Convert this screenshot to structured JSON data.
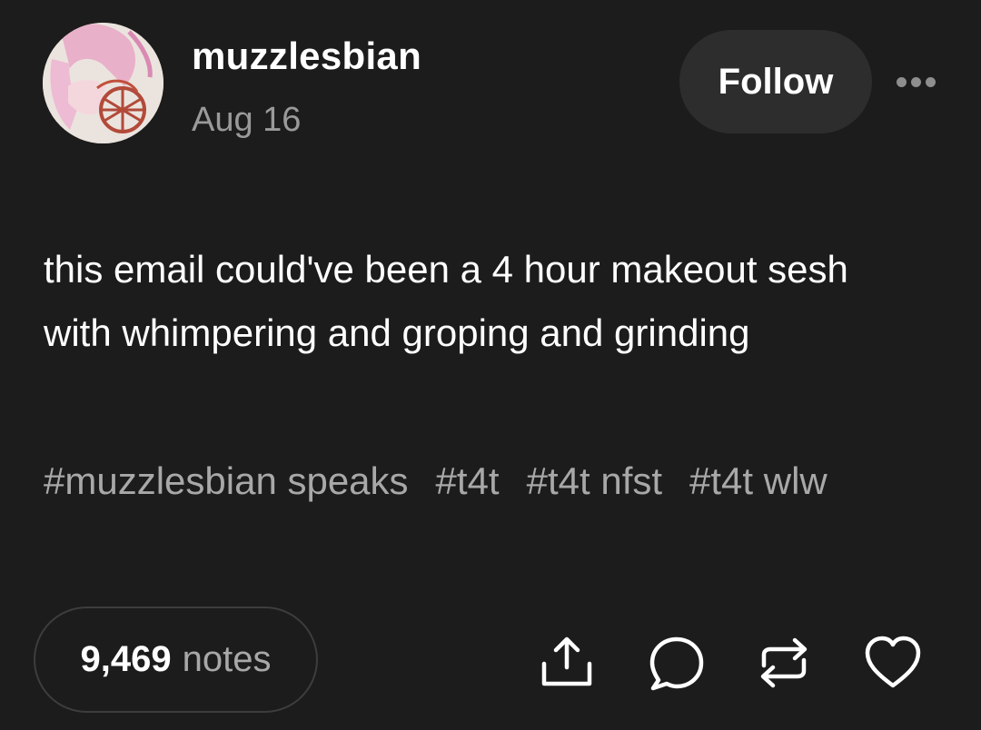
{
  "post": {
    "username": "muzzlesbian",
    "date": "Aug 16",
    "follow_label": "Follow",
    "text": "this email could've been a 4 hour makeout sesh with whimpering and groping and grinding",
    "tags": [
      "#muzzlesbian speaks",
      "#t4t",
      "#t4t nfst",
      "#t4t wlw"
    ],
    "notes_count": "9,469",
    "notes_label": "notes"
  },
  "icons": {
    "more": "more-horizontal-icon",
    "share": "share-icon",
    "reply": "reply-icon",
    "reblog": "reblog-icon",
    "like": "heart-icon"
  },
  "colors": {
    "background": "#1c1c1c",
    "follow_button_bg": "#2d2d2d",
    "secondary_text": "#9a9a9a",
    "tag_text": "#a8a8a8",
    "icon": "#ffffff"
  }
}
